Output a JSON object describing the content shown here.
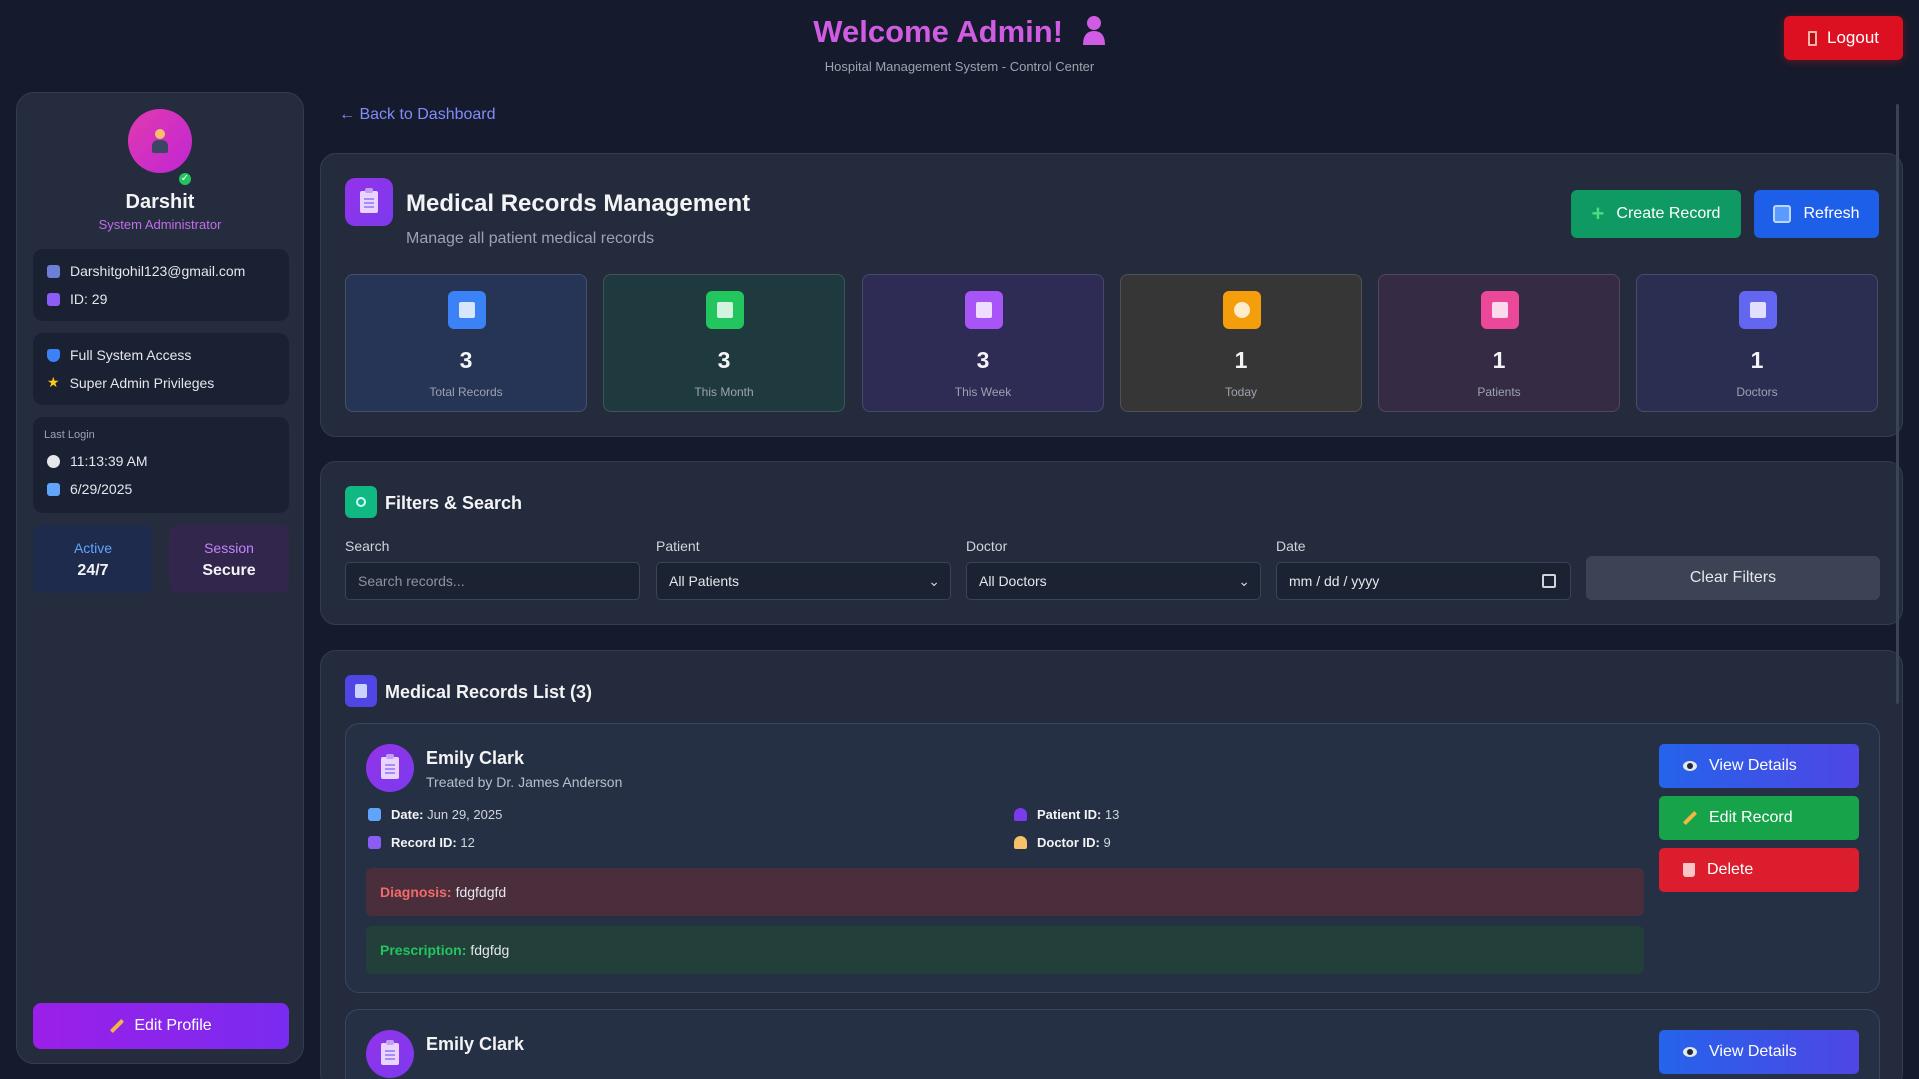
{
  "header": {
    "welcome": "Welcome Admin!",
    "subtitle": "Hospital Management System - Control Center",
    "logout_label": "Logout"
  },
  "sidebar": {
    "name": "Darshit",
    "role": "System Administrator",
    "email": "Darshitgohil123@gmail.com",
    "id": "ID: 29",
    "access": "Full System Access",
    "privileges": "Super Admin Privileges",
    "last_login_label": "Last Login",
    "last_login_time": "11:13:39 AM",
    "last_login_date": "6/29/2025",
    "active_label": "Active",
    "active_value": "24/7",
    "session_label": "Session",
    "session_value": "Secure",
    "edit_profile_label": "Edit Profile"
  },
  "back_link": "← Back to Dashboard",
  "page": {
    "title": "Medical Records Management",
    "subtitle": "Manage all patient medical records",
    "create_label": "Create Record",
    "refresh_label": "Refresh"
  },
  "stats": [
    {
      "value": "3",
      "label": "Total Records",
      "color": "#3b82f6"
    },
    {
      "value": "3",
      "label": "This Month",
      "color": "#22c55e"
    },
    {
      "value": "3",
      "label": "This Week",
      "color": "#a855f7"
    },
    {
      "value": "1",
      "label": "Today",
      "color": "#f59e0b"
    },
    {
      "value": "1",
      "label": "Patients",
      "color": "#ec4899"
    },
    {
      "value": "1",
      "label": "Doctors",
      "color": "#6366f1"
    }
  ],
  "filters": {
    "title": "Filters & Search",
    "search_label": "Search",
    "search_placeholder": "Search records...",
    "patient_label": "Patient",
    "patient_value": "All Patients",
    "doctor_label": "Doctor",
    "doctor_value": "All Doctors",
    "date_label": "Date",
    "date_placeholder": "mm / dd / yyyy",
    "clear_label": "Clear Filters"
  },
  "records_list": {
    "title": "Medical Records List (3)",
    "records": [
      {
        "name": "Emily Clark",
        "treated_by": "Treated by Dr. James Anderson",
        "date_label": "Date:",
        "date": "Jun 29, 2025",
        "record_id_label": "Record ID:",
        "record_id": "12",
        "patient_id_label": "Patient ID:",
        "patient_id": "13",
        "doctor_id_label": "Doctor ID:",
        "doctor_id": "9",
        "diagnosis_label": "Diagnosis:",
        "diagnosis": "fdgfdgfd",
        "prescription_label": "Prescription:",
        "prescription": "fdgfdg",
        "view_label": "View Details",
        "edit_label": "Edit Record",
        "delete_label": "Delete"
      },
      {
        "name": "Emily Clark",
        "view_label": "View Details"
      }
    ]
  }
}
